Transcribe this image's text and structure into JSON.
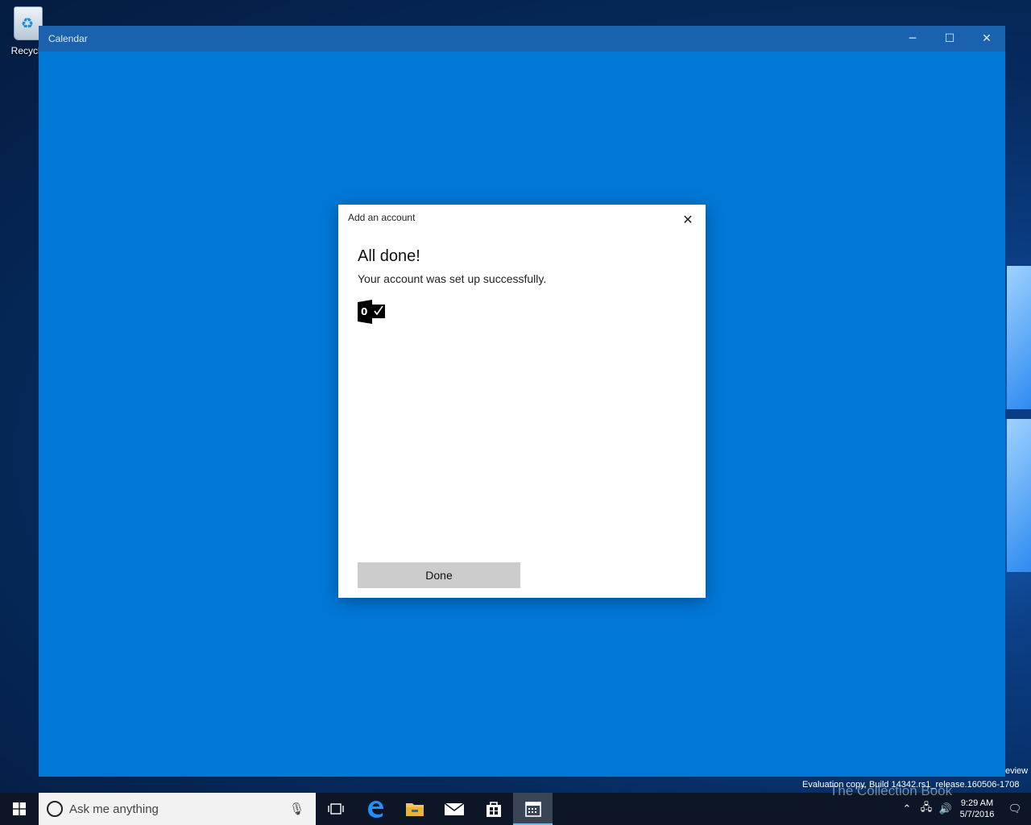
{
  "desktop": {
    "recycle_bin_label": "Recycle"
  },
  "window": {
    "title": "Calendar",
    "minimize": "─",
    "maximize": "☐",
    "close": "✕"
  },
  "dialog": {
    "title": "Add an account",
    "close": "✕",
    "heading": "All done!",
    "message": "Your account was set up successfully.",
    "done_label": "Done"
  },
  "watermark": {
    "eval": "Evaluation copy. Build 14342.rs1_release.160506-1708",
    "preview": "eview",
    "brand": "The Collection Book"
  },
  "taskbar": {
    "search_placeholder": "Ask me anything",
    "time": "9:29 AM",
    "date": "5/7/2016"
  },
  "colors": {
    "accent": "#0078d7",
    "taskbar": "#0c1626"
  }
}
